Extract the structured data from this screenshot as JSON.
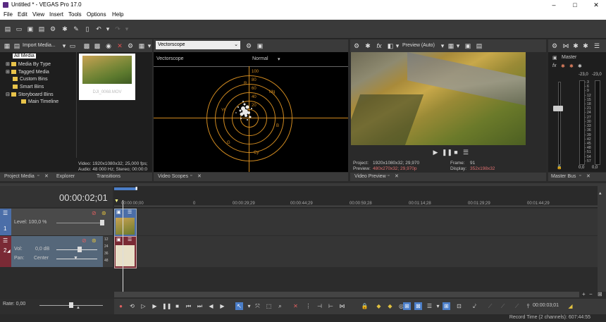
{
  "window": {
    "title": "Untitled * - VEGAS Pro 17.0",
    "minimize": "–",
    "maximize": "□",
    "close": "✕"
  },
  "menu": [
    "File",
    "Edit",
    "View",
    "Insert",
    "Tools",
    "Options",
    "Help"
  ],
  "project_media": {
    "import_label": "Import Media...",
    "tree": [
      "All Media",
      "Media By Type",
      "Tagged Media",
      "Custom Bins",
      "Smart Bins",
      "Storyboard Bins",
      "Main Timeline"
    ],
    "thumb_caption": "DJI_0068.MOV",
    "info_video": "Video: 1920x1080x32; 25,000 fps;",
    "info_audio": "Audio: 48 000 Hz; Stereo; 00:00:0",
    "tabs": [
      "Project Media",
      "Explorer",
      "Transitions"
    ]
  },
  "scopes": {
    "dropdown": "Vectorscope",
    "label": "Vectorscope",
    "mode": "Normal",
    "ticks": [
      "100",
      "80",
      "60",
      "40",
      "20"
    ],
    "targets": [
      "R",
      "Mg",
      "B",
      "Cy",
      "G",
      "Yl"
    ],
    "tab": "Video Scopes"
  },
  "preview": {
    "mode": "Preview (Auto)",
    "project_label": "Project:",
    "project_value": "1920x1080x32; 29,970",
    "preview_label": "Preview:",
    "preview_value": "480x270x32; 29,970p",
    "frame_label": "Frame:",
    "frame_value": "91",
    "display_label": "Display:",
    "display_value": "352x198x32",
    "tab": "Video Preview"
  },
  "master": {
    "label": "Master",
    "peak_l": "-23,0",
    "peak_r": "-23,0",
    "scale": [
      "3",
      "6",
      "9",
      "12",
      "15",
      "18",
      "21",
      "24",
      "27",
      "30",
      "33",
      "36",
      "39",
      "42",
      "45",
      "48",
      "51",
      "54",
      "57"
    ],
    "val_l": "0,0",
    "val_r": "0,0",
    "tab": "Master Bus"
  },
  "timeline": {
    "timecode": "00:00:02;01",
    "ruler": [
      "00:00:00;00",
      "00:00:29;29",
      "00:00:44;29",
      "00:00:59;28",
      "00:01:14;28",
      "00:01:29;29",
      "00:01:44;29"
    ],
    "video_track": {
      "number": "1",
      "level_label": "Level: 100,0 %"
    },
    "audio_track": {
      "number": "2",
      "vol_label": "Vol:",
      "vol_value": "0,0 dB",
      "pan_label": "Pan:",
      "pan_value": "Center",
      "meter_marks": [
        "12",
        "24",
        "36",
        "48"
      ]
    },
    "rate_label": "Rate: 0,00",
    "cursor_time": "00:00:03;01",
    "record_time": "Record Time (2 channels): 607:44:55"
  },
  "colors": {
    "accent": "#4b7ec8",
    "audio_track": "#7a2a35",
    "scope_graticule": "#d08a20"
  }
}
